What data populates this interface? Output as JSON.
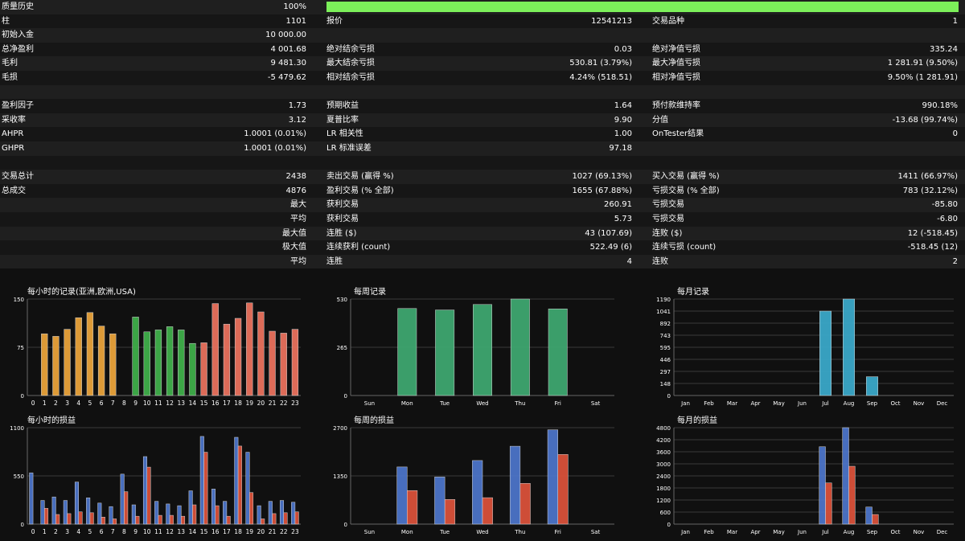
{
  "stats": {
    "quality": {
      "label": "质量历史",
      "value": "100%",
      "percent": 100
    },
    "rows": [
      {
        "c1": {
          "label": "柱",
          "value": "1101"
        },
        "c2": {
          "label": "报价",
          "value": "12541213"
        },
        "c3": {
          "label": "交易品种",
          "value": "1"
        }
      },
      {
        "c1": {
          "label": "初始入金",
          "value": "10 000.00"
        },
        "c2": {
          "label": "",
          "value": ""
        },
        "c3": {
          "label": "",
          "value": ""
        }
      },
      {
        "c1": {
          "label": "总净盈利",
          "value": "4 001.68"
        },
        "c2": {
          "label": "绝对结余亏损",
          "value": "0.03"
        },
        "c3": {
          "label": "绝对净值亏损",
          "value": "335.24"
        }
      },
      {
        "c1": {
          "label": "毛利",
          "value": "9 481.30"
        },
        "c2": {
          "label": "最大结余亏损",
          "value": "530.81 (3.79%)"
        },
        "c3": {
          "label": "最大净值亏损",
          "value": "1 281.91 (9.50%)"
        }
      },
      {
        "c1": {
          "label": "毛损",
          "value": "-5 479.62"
        },
        "c2": {
          "label": "相对结余亏损",
          "value": "4.24% (518.51)"
        },
        "c3": {
          "label": "相对净值亏损",
          "value": "9.50% (1 281.91)"
        }
      },
      {
        "c1": {
          "label": "",
          "value": ""
        },
        "c2": {
          "label": "",
          "value": ""
        },
        "c3": {
          "label": "",
          "value": ""
        }
      },
      {
        "c1": {
          "label": "盈利因子",
          "value": "1.73"
        },
        "c2": {
          "label": "预期收益",
          "value": "1.64"
        },
        "c3": {
          "label": "预付款维持率",
          "value": "990.18%"
        }
      },
      {
        "c1": {
          "label": "采收率",
          "value": "3.12"
        },
        "c2": {
          "label": "夏普比率",
          "value": "9.90"
        },
        "c3": {
          "label": "分值",
          "value": "-13.68 (99.74%)"
        }
      },
      {
        "c1": {
          "label": "AHPR",
          "value": "1.0001 (0.01%)"
        },
        "c2": {
          "label": "LR 相关性",
          "value": "1.00"
        },
        "c3": {
          "label": "OnTester结果",
          "value": "0"
        }
      },
      {
        "c1": {
          "label": "GHPR",
          "value": "1.0001 (0.01%)"
        },
        "c2": {
          "label": "LR 标准误差",
          "value": "97.18"
        },
        "c3": {
          "label": "",
          "value": ""
        }
      },
      {
        "c1": {
          "label": "",
          "value": ""
        },
        "c2": {
          "label": "",
          "value": ""
        },
        "c3": {
          "label": "",
          "value": ""
        }
      },
      {
        "c1": {
          "label": "交易总计",
          "value": "2438"
        },
        "c2": {
          "label": "卖出交易 (赢得 %)",
          "value": "1027 (69.13%)"
        },
        "c3": {
          "label": "买入交易 (赢得 %)",
          "value": "1411 (66.97%)"
        }
      },
      {
        "c1": {
          "label": "总成交",
          "value": "4876"
        },
        "c2": {
          "label": "盈利交易 (% 全部)",
          "value": "1655 (67.88%)"
        },
        "c3": {
          "label": "亏损交易 (% 全部)",
          "value": "783 (32.12%)"
        }
      },
      {
        "c1": {
          "label": "",
          "value": "最大"
        },
        "c2": {
          "label": "获利交易",
          "value": "260.91"
        },
        "c3": {
          "label": "亏损交易",
          "value": "-85.80"
        }
      },
      {
        "c1": {
          "label": "",
          "value": "平均"
        },
        "c2": {
          "label": "获利交易",
          "value": "5.73"
        },
        "c3": {
          "label": "亏损交易",
          "value": "-6.80"
        }
      },
      {
        "c1": {
          "label": "",
          "value": "最大值"
        },
        "c2": {
          "label": "连胜 ($)",
          "value": "43 (107.69)"
        },
        "c3": {
          "label": "连败 ($)",
          "value": "12 (-518.45)"
        }
      },
      {
        "c1": {
          "label": "",
          "value": "极大值"
        },
        "c2": {
          "label": "连续获利 (count)",
          "value": "522.49 (6)"
        },
        "c3": {
          "label": "连续亏损 (count)",
          "value": "-518.45 (12)"
        }
      },
      {
        "c1": {
          "label": "",
          "value": "平均"
        },
        "c2": {
          "label": "连胜",
          "value": "4"
        },
        "c3": {
          "label": "连败",
          "value": "2"
        }
      }
    ]
  },
  "colors": {
    "orange": "#e8a23a",
    "green": "#3fae49",
    "red": "#e8705c",
    "teal": "#3aa7c8",
    "sea": "#3ea66f",
    "blue": "#4c74c8",
    "loss": "#d9513a",
    "progress": "#7cf05a"
  },
  "chart_data": [
    {
      "id": "hourly_records",
      "type": "bar",
      "title": "每小时的记录(亚洲,欧洲,USA)",
      "categories": [
        "0",
        "1",
        "2",
        "3",
        "4",
        "5",
        "6",
        "7",
        "8",
        "9",
        "10",
        "11",
        "12",
        "13",
        "14",
        "15",
        "16",
        "17",
        "18",
        "19",
        "20",
        "21",
        "22",
        "23"
      ],
      "values": [
        0,
        96,
        92,
        103,
        121,
        129,
        108,
        96,
        0,
        122,
        99,
        102,
        107,
        102,
        81,
        82,
        143,
        111,
        120,
        144,
        130,
        100,
        97,
        103
      ],
      "ylim": [
        0,
        150
      ],
      "yticks": [
        "0",
        "75",
        "150"
      ],
      "color_groups": [
        "orange",
        "orange",
        "orange",
        "orange",
        "orange",
        "orange",
        "orange",
        "orange",
        "orange",
        "green",
        "green",
        "green",
        "green",
        "green",
        "green",
        "red",
        "red",
        "red",
        "red",
        "red",
        "red",
        "red",
        "red",
        "red"
      ]
    },
    {
      "id": "weekly_records",
      "type": "bar",
      "title": "每周记录",
      "categories": [
        "Sun",
        "Mon",
        "Tue",
        "Wed",
        "Thu",
        "Fri",
        "Sat"
      ],
      "values": [
        0,
        478,
        470,
        500,
        530,
        476,
        0
      ],
      "ylim": [
        0,
        530
      ],
      "yticks": [
        "0",
        "265",
        "530"
      ],
      "color": "sea"
    },
    {
      "id": "monthly_records",
      "type": "bar",
      "title": "每月记录",
      "categories": [
        "Jan",
        "Feb",
        "Mar",
        "Apr",
        "May",
        "Jun",
        "Jul",
        "Aug",
        "Sep",
        "Oct",
        "Nov",
        "Dec"
      ],
      "values": [
        0,
        0,
        0,
        0,
        0,
        0,
        1041,
        1190,
        232,
        0,
        0,
        0
      ],
      "ylim": [
        0,
        1190
      ],
      "yticks": [
        "0",
        "148",
        "297",
        "446",
        "595",
        "743",
        "892",
        "1041",
        "1190"
      ],
      "color": "teal"
    },
    {
      "id": "hourly_pnl",
      "type": "bar",
      "title": "每小时的损益",
      "categories": [
        "0",
        "1",
        "2",
        "3",
        "4",
        "5",
        "6",
        "7",
        "8",
        "9",
        "10",
        "11",
        "12",
        "13",
        "14",
        "15",
        "16",
        "17",
        "18",
        "19",
        "20",
        "21",
        "22",
        "23"
      ],
      "series": [
        {
          "values": [
            585,
            270,
            310,
            270,
            480,
            300,
            240,
            200,
            570,
            220,
            770,
            260,
            230,
            210,
            380,
            1000,
            400,
            260,
            990,
            820,
            210,
            260,
            270,
            250
          ]
        },
        {
          "values": [
            0,
            180,
            110,
            120,
            140,
            130,
            80,
            60,
            370,
            90,
            650,
            100,
            100,
            90,
            220,
            820,
            210,
            90,
            890,
            360,
            60,
            120,
            130,
            140
          ]
        }
      ],
      "ylim": [
        0,
        1100
      ],
      "yticks": [
        "0",
        "550",
        "1100"
      ]
    },
    {
      "id": "weekly_pnl",
      "type": "bar",
      "title": "每周的损益",
      "categories": [
        "Sun",
        "Mon",
        "Tue",
        "Wed",
        "Thu",
        "Fri",
        "Sat"
      ],
      "series": [
        {
          "values": [
            0,
            1600,
            1320,
            1780,
            2180,
            2640,
            0
          ]
        },
        {
          "values": [
            0,
            940,
            690,
            740,
            1140,
            1950,
            0
          ]
        }
      ],
      "ylim": [
        0,
        2700
      ],
      "yticks": [
        "0",
        "1350",
        "2700"
      ]
    },
    {
      "id": "monthly_pnl",
      "type": "bar",
      "title": "每月的损益",
      "categories": [
        "Jan",
        "Feb",
        "Mar",
        "Apr",
        "May",
        "Jun",
        "Jul",
        "Aug",
        "Sep",
        "Oct",
        "Nov",
        "Dec"
      ],
      "series": [
        {
          "values": [
            0,
            0,
            0,
            0,
            0,
            0,
            3850,
            4800,
            850,
            0,
            0,
            0
          ]
        },
        {
          "values": [
            0,
            0,
            0,
            0,
            0,
            0,
            2050,
            2880,
            480,
            0,
            0,
            0
          ]
        }
      ],
      "ylim": [
        0,
        4800
      ],
      "yticks": [
        "0",
        "600",
        "1200",
        "1800",
        "2400",
        "3000",
        "3600",
        "4200",
        "4800"
      ]
    }
  ]
}
